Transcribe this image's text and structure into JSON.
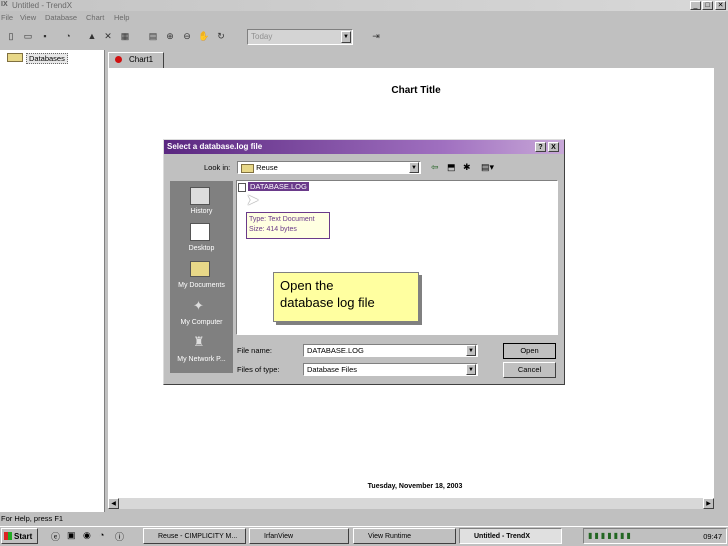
{
  "window": {
    "icon_text": "IX",
    "title": "Untitled - TrendX"
  },
  "menu": [
    "File",
    "View",
    "Database",
    "Chart",
    "Help"
  ],
  "toolbar": {
    "date_select_value": "Today"
  },
  "tree": {
    "root_label": "Databases"
  },
  "tab": {
    "label": "Chart1"
  },
  "chart": {
    "title": "Chart Title",
    "date_label": "Tuesday, November 18, 2003"
  },
  "dialog": {
    "title": "Select a database.log file",
    "help_button": "?",
    "close_button": "X",
    "look_in_label": "Look in:",
    "look_in_value": "Reuse",
    "places": [
      "History",
      "Desktop",
      "My Documents",
      "My Computer",
      "My Network P..."
    ],
    "file_item": "DATABASE.LOG",
    "tooltip_line1": "Type: Text Document",
    "tooltip_line2": "Size: 414 bytes",
    "file_name_label": "File name:",
    "file_name_value": "DATABASE.LOG",
    "file_type_label": "Files of type:",
    "file_type_value": "Database Files",
    "open_button": "Open",
    "cancel_button": "Cancel"
  },
  "callout": {
    "line1": "Open the",
    "line2": "database log file"
  },
  "status": {
    "text": "For Help, press F1"
  },
  "taskbar": {
    "start_label": "Start",
    "tasks": [
      "Reuse - CIMPLICITY M...",
      "IrfanView",
      "View Runtime",
      "Untitled - TrendX"
    ],
    "clock": "09:47"
  }
}
